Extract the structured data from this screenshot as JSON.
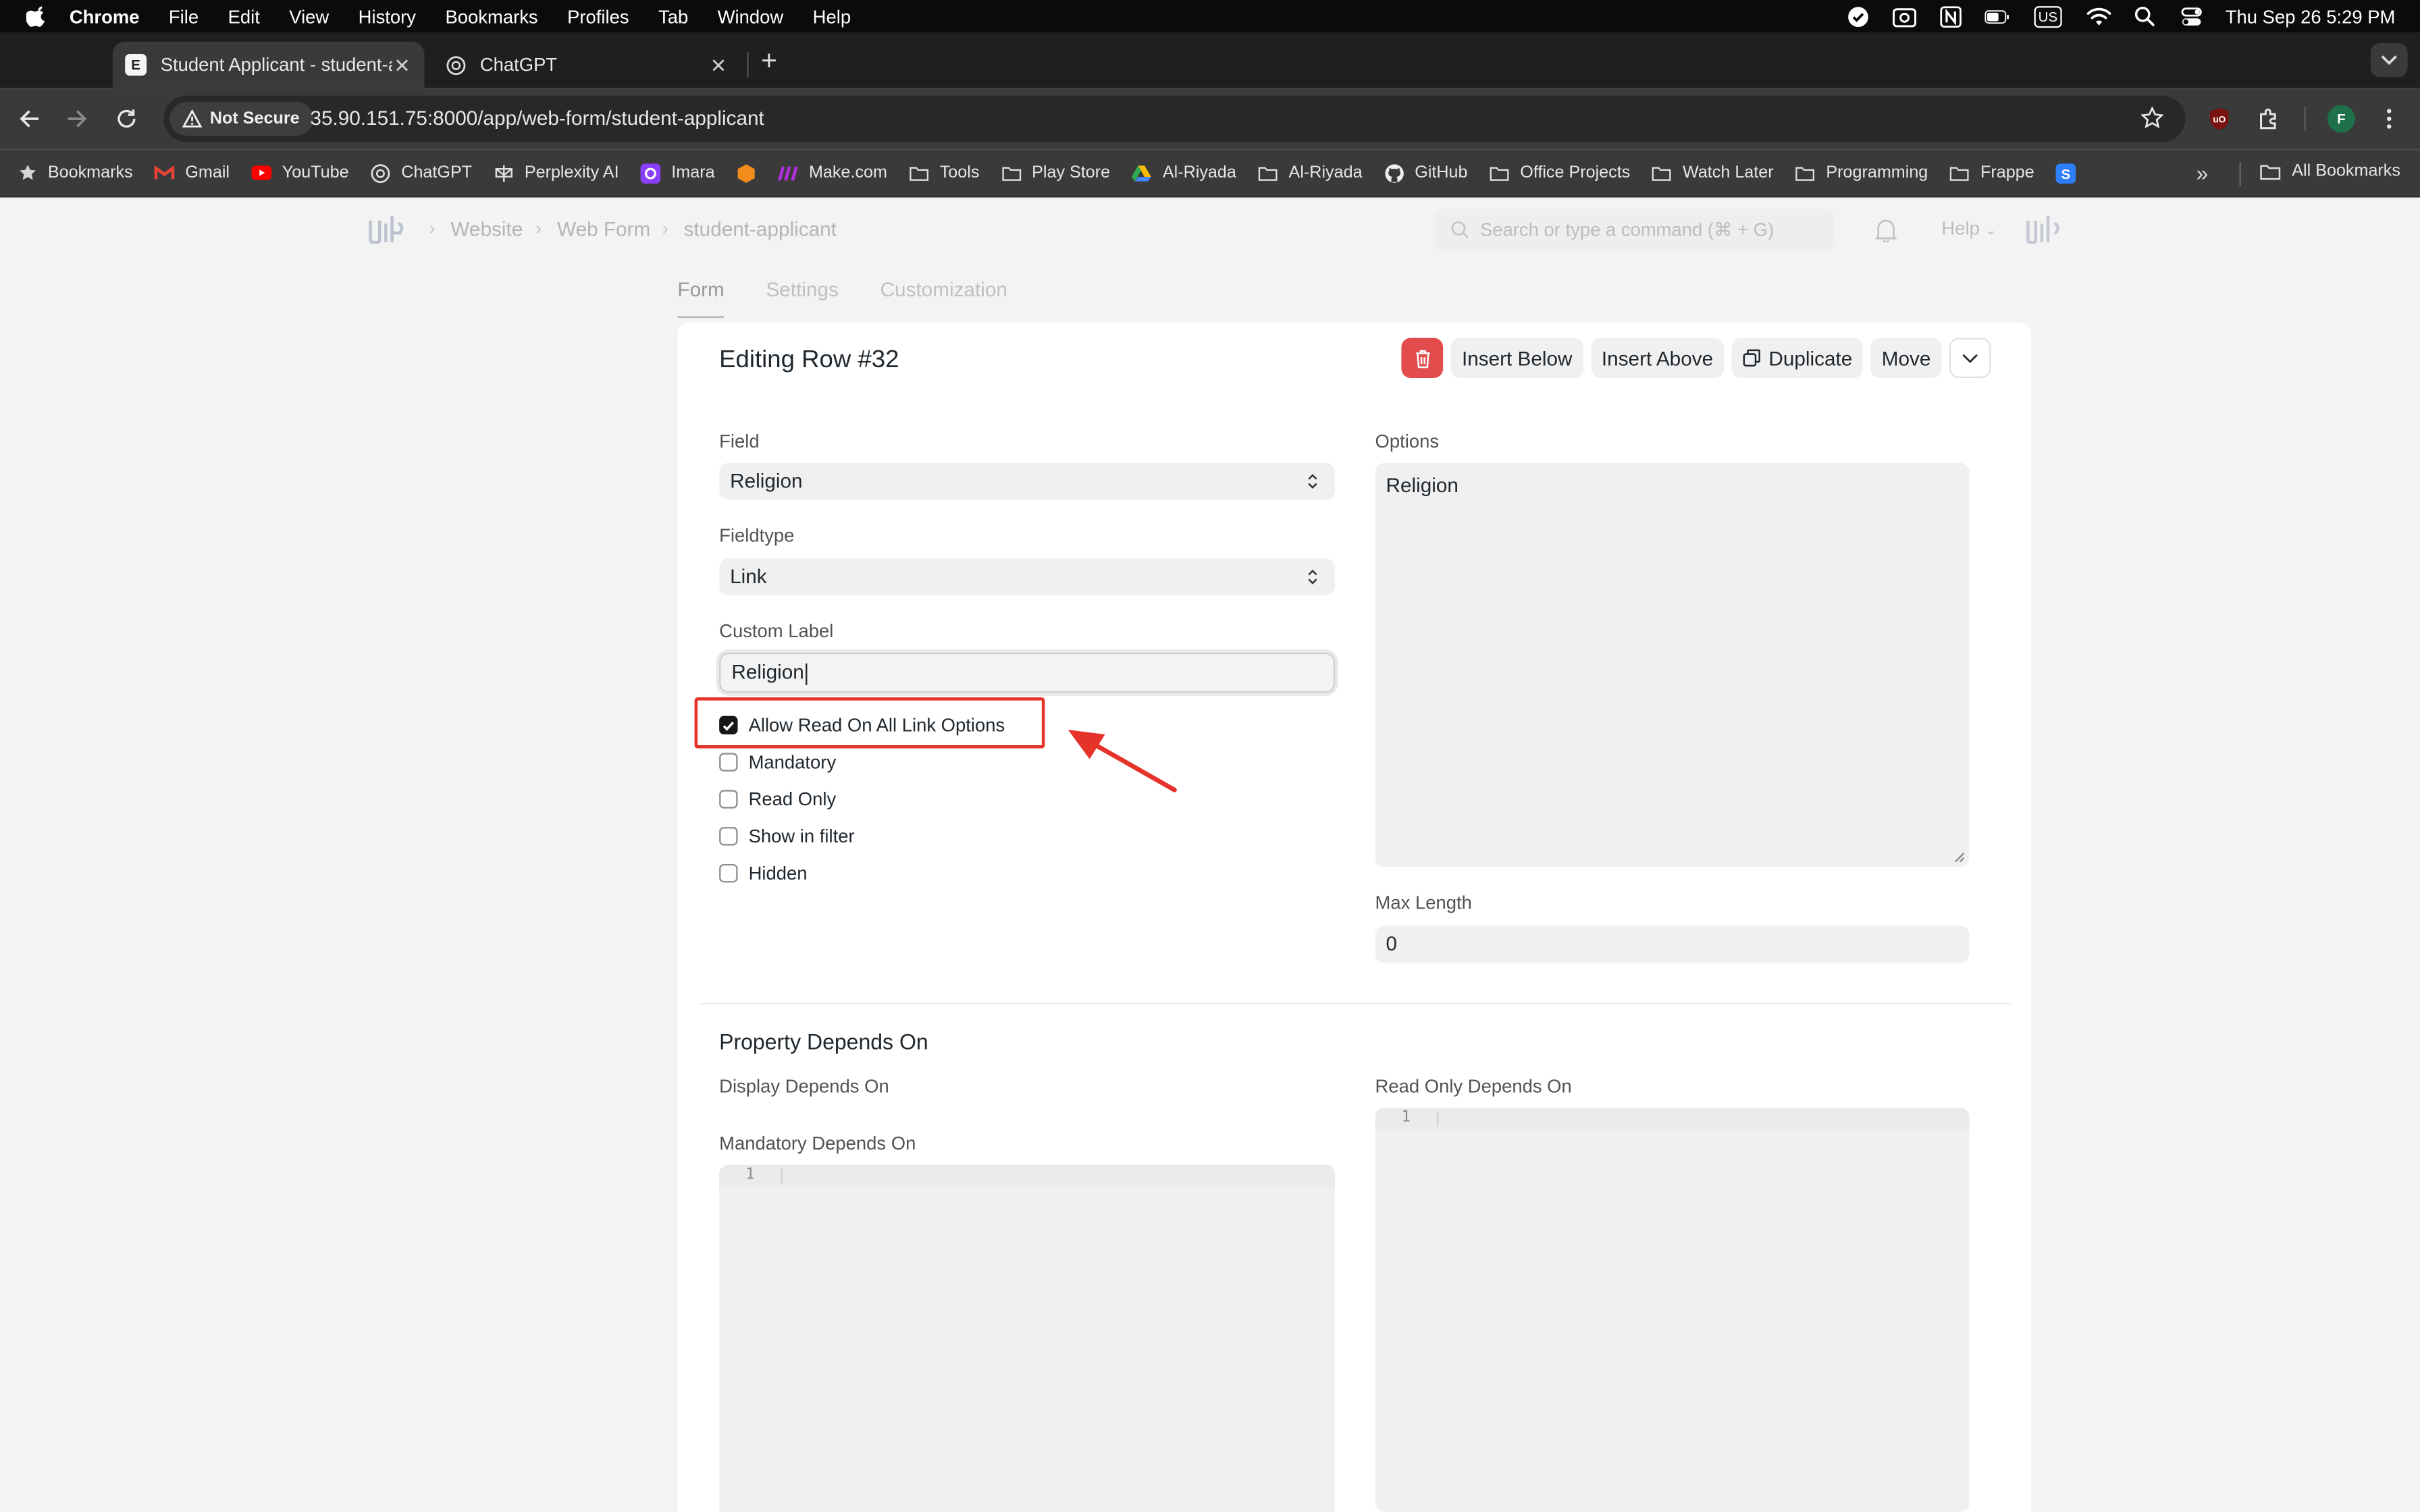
{
  "menubar": {
    "app": "Chrome",
    "items": [
      "File",
      "Edit",
      "View",
      "History",
      "Bookmarks",
      "Profiles",
      "Tab",
      "Window",
      "Help"
    ],
    "clock": "Thu Sep 26  5:29 PM",
    "keyboard": "US"
  },
  "tabs": [
    {
      "title": "Student Applicant - student-a",
      "favicon": "E"
    },
    {
      "title": "ChatGPT"
    }
  ],
  "toolbar": {
    "security": "Not Secure",
    "url": "35.90.151.75:8000/app/web-form/student-applicant",
    "profile": "F"
  },
  "bookmarks": [
    {
      "label": "Bookmarks",
      "icon": "star-icon"
    },
    {
      "label": "Gmail",
      "icon": "gmail-icon"
    },
    {
      "label": "YouTube",
      "icon": "youtube-icon"
    },
    {
      "label": "ChatGPT",
      "icon": "chatgpt-icon"
    },
    {
      "label": "Perplexity AI",
      "icon": "perplexity-icon"
    },
    {
      "label": "Imara",
      "icon": "imara-icon"
    },
    {
      "label": "",
      "icon": "cube-icon"
    },
    {
      "label": "Make.com",
      "icon": "make-icon"
    },
    {
      "label": "Tools",
      "icon": "folder-icon"
    },
    {
      "label": "Play Store",
      "icon": "folder-icon"
    },
    {
      "label": "Al-Riyada",
      "icon": "drive-icon"
    },
    {
      "label": "Al-Riyada",
      "icon": "folder-icon"
    },
    {
      "label": "GitHub",
      "icon": "github-icon"
    },
    {
      "label": "Office Projects",
      "icon": "folder-icon"
    },
    {
      "label": "Watch Later",
      "icon": "folder-icon"
    },
    {
      "label": "Programming",
      "icon": "folder-icon"
    },
    {
      "label": "Frappe",
      "icon": "folder-icon"
    },
    {
      "label": "",
      "icon": "s-icon"
    }
  ],
  "all_bookmarks": "All Bookmarks",
  "page": {
    "breadcrumbs": [
      "Website",
      "Web Form",
      "student-applicant"
    ],
    "search_placeholder": "Search or type a command (⌘ + G)",
    "help": "Help",
    "form_tabs": [
      "Form",
      "Settings",
      "Customization"
    ]
  },
  "editor": {
    "title": "Editing Row #32",
    "buttons": {
      "insert_below": "Insert Below",
      "insert_above": "Insert Above",
      "duplicate": "Duplicate",
      "move": "Move"
    },
    "field_label": "Field",
    "field_value": "Religion",
    "fieldtype_label": "Fieldtype",
    "fieldtype_value": "Link",
    "custom_label_label": "Custom Label",
    "custom_label_value": "Religion",
    "checkboxes": [
      {
        "label": "Allow Read On All Link Options",
        "checked": true
      },
      {
        "label": "Mandatory",
        "checked": false
      },
      {
        "label": "Read Only",
        "checked": false
      },
      {
        "label": "Show in filter",
        "checked": false
      },
      {
        "label": "Hidden",
        "checked": false
      }
    ],
    "options_label": "Options",
    "options_value": "Religion",
    "max_length_label": "Max Length",
    "max_length_value": "0",
    "section_title": "Property Depends On",
    "display_depends_label": "Display Depends On",
    "mandatory_depends_label": "Mandatory Depends On",
    "readonly_depends_label": "Read Only Depends On",
    "line_number": "1"
  },
  "annotation_color": "#e6332a"
}
